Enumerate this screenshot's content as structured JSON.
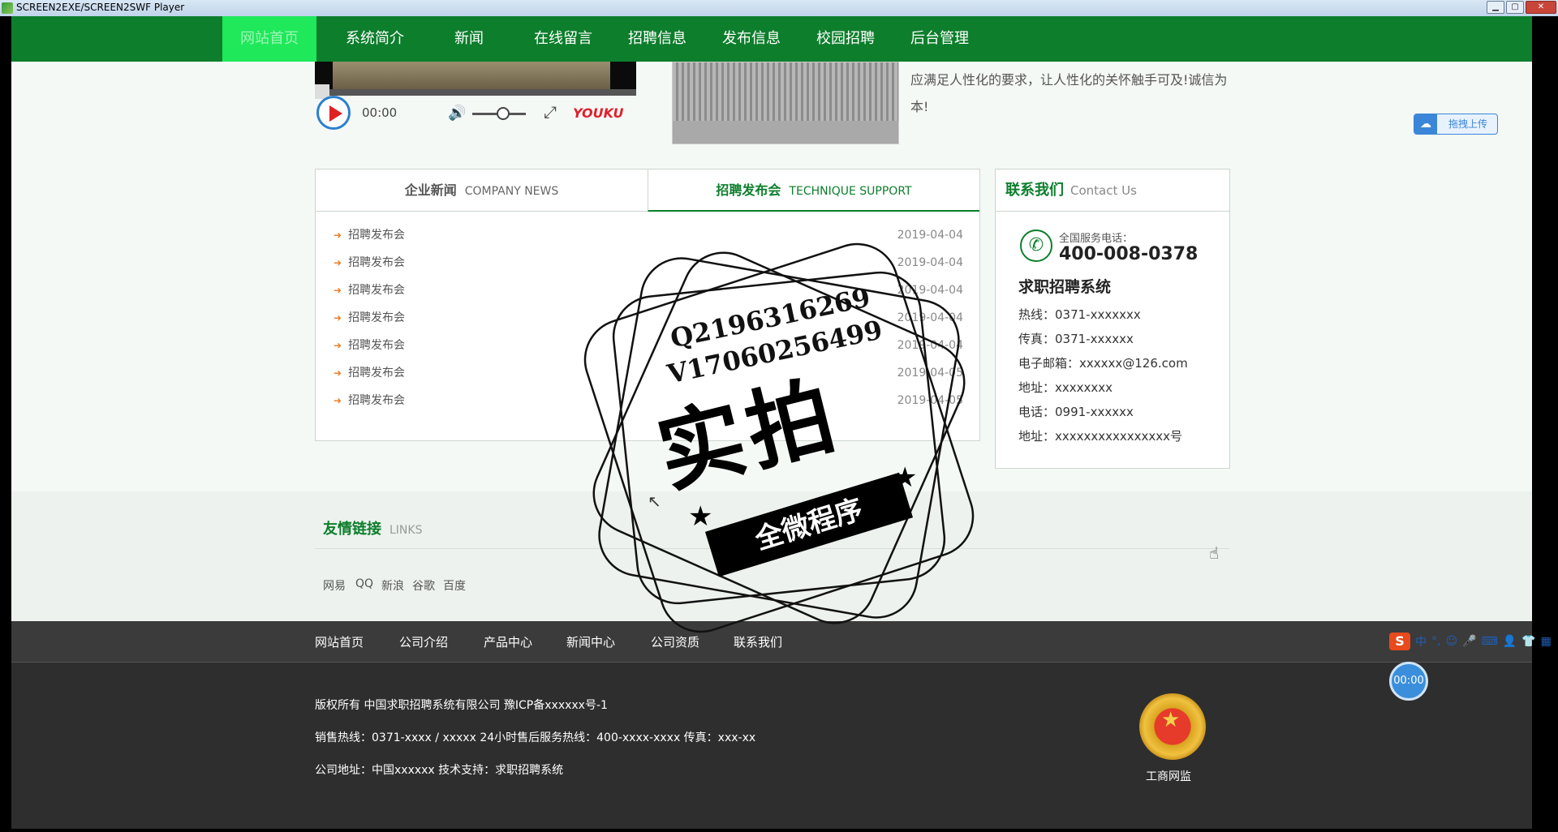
{
  "window": {
    "title": "SCREEN2EXE/SCREEN2SWF Player"
  },
  "nav": {
    "items": [
      "网站首页",
      "系统简介",
      "新闻",
      "在线留言",
      "招聘信息",
      "发布信息",
      "校园招聘",
      "后台管理"
    ],
    "active": "网站首页"
  },
  "video": {
    "time": "00:00",
    "brand": "YOUKU"
  },
  "intro": {
    "text": "应满足人性化的要求，让人性化的关怀触手可及!诚信为本!"
  },
  "upload": {
    "label": "拖拽上传"
  },
  "news": {
    "tabs": [
      {
        "cn": "企业新闻",
        "en": "COMPANY NEWS"
      },
      {
        "cn": "招聘发布会",
        "en": "TECHNIQUE SUPPORT"
      }
    ],
    "items": [
      {
        "title": "招聘发布会",
        "date": "2019-04-04"
      },
      {
        "title": "招聘发布会",
        "date": "2019-04-04"
      },
      {
        "title": "招聘发布会",
        "date": "2019-04-04"
      },
      {
        "title": "招聘发布会",
        "date": "2019-04-04"
      },
      {
        "title": "招聘发布会",
        "date": "2019-04-04"
      },
      {
        "title": "招聘发布会",
        "date": "2019-04-05"
      },
      {
        "title": "招聘发布会",
        "date": "2019-04-05"
      }
    ]
  },
  "contact": {
    "title_cn": "联系我们",
    "title_en": "Contact Us",
    "hotline_label": "全国服务电话：",
    "hotline": "400-008-0378",
    "company": "求职招聘系统",
    "lines": [
      "热线：0371-xxxxxxx",
      "传真：0371-xxxxxx",
      "电子邮箱：xxxxxx@126.com",
      "地址：xxxxxxxx",
      "电话：0991-xxxxxx",
      "地址：xxxxxxxxxxxxxxxx号"
    ]
  },
  "links": {
    "title_cn": "友情链接",
    "title_en": "LINKS",
    "items": [
      "网易",
      "QQ",
      "新浪",
      "谷歌",
      "百度"
    ]
  },
  "footer_nav": [
    "网站首页",
    "公司介绍",
    "产品中心",
    "新闻中心",
    "公司资质",
    "联系我们"
  ],
  "footer": {
    "copyright": "版权所有 中国求职招聘系统有限公司 豫ICP备xxxxxx号-1",
    "hotline": "销售热线：0371-xxxx / xxxxx 24小时售后服务热线：400-xxxx-xxxx 传真：xxx-xx",
    "address": "公司地址：中国xxxxxx 技术支持：求职招聘系统",
    "emblem_label": "工商网监"
  },
  "watermark": {
    "line1": "Q2196316269",
    "line2": "V17060256499",
    "big": "实拍",
    "banner": "全微程序"
  },
  "overlay": {
    "timer": "00:00",
    "ime_logo": "S",
    "ime_items": [
      "中",
      "°,",
      "☺",
      "🎤",
      "⌨",
      "👤",
      "👕",
      "▦"
    ]
  },
  "colors": {
    "nav_green": "#0d7e2c",
    "nav_active": "#1fe85a",
    "footer_dark": "#2e2e2e",
    "accent_orange": "#e8802a"
  }
}
